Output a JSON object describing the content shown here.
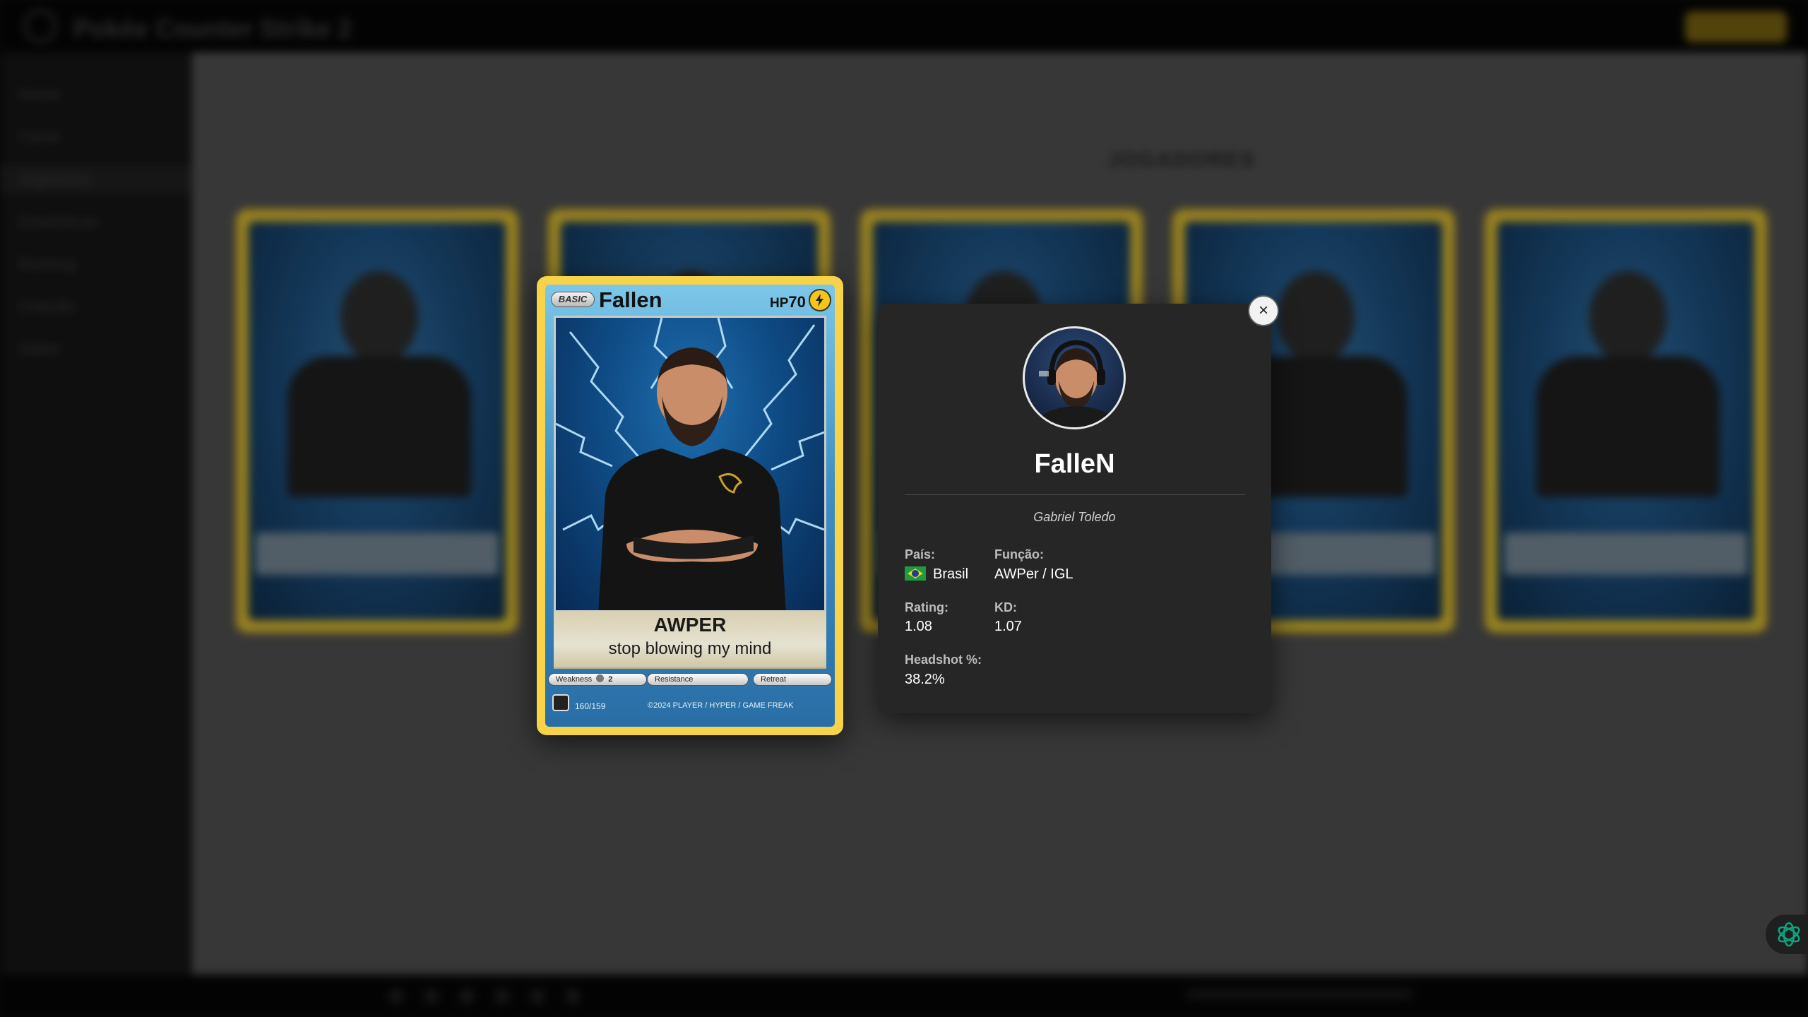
{
  "app": {
    "title": "Pokée Counter Strike 2",
    "cta_label": ""
  },
  "sidebar": {
    "items": [
      "Home",
      "Cards",
      "Jogadores",
      "Estatísticas",
      "Ranking",
      "Coleção",
      "Sobre"
    ],
    "active_index": 2
  },
  "main": {
    "heading": "JOGADORES"
  },
  "card": {
    "stage": "BASIC",
    "name": "Fallen",
    "hp_prefix": "HP",
    "hp": "70",
    "energy_type": "lightning-icon",
    "attack_name": "AWPER",
    "attack_text": "stop blowing my mind",
    "weakness_label": "Weakness",
    "weakness_value": "2",
    "resistance_label": "Resistance",
    "retreat_label": "Retreat",
    "number": "160/159",
    "copyright": "©2024 PLAYER / HYPER / GAME FREAK",
    "border_color": "#f7d34a"
  },
  "panel": {
    "nickname": "FalleN",
    "real_name": "Gabriel Toledo",
    "country_label": "País:",
    "country_value": "Brasil",
    "country_flag": "brazil-flag-icon",
    "role_label": "Função:",
    "role_value": "AWPer / IGL",
    "rating_label": "Rating:",
    "rating_value": "1.08",
    "kd_label": "KD:",
    "kd_value": "1.07",
    "hs_label": "Headshot %:",
    "hs_value": "38.2%",
    "close_label": "×"
  },
  "colors": {
    "accent": "#f7d34a",
    "panel_bg": "#262626",
    "assistant": "#10a37f"
  }
}
